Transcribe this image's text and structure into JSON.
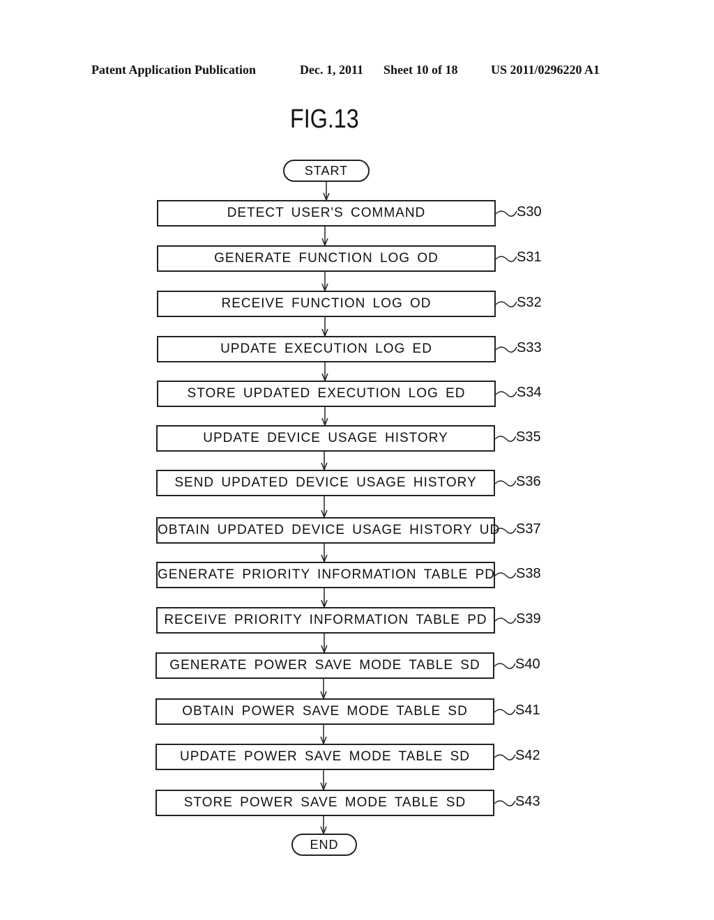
{
  "header": {
    "left": "Patent Application Publication",
    "date": "Dec. 1, 2011",
    "sheet": "Sheet 10 of 18",
    "number": "US 2011/0296220 A1"
  },
  "figure": {
    "title": "FIG.13",
    "start": "START",
    "end": "END",
    "steps": [
      {
        "id": "S30",
        "label": "DETECT USER'S COMMAND"
      },
      {
        "id": "S31",
        "label": "GENERATE FUNCTION LOG OD"
      },
      {
        "id": "S32",
        "label": "RECEIVE FUNCTION LOG OD"
      },
      {
        "id": "S33",
        "label": "UPDATE EXECUTION LOG ED"
      },
      {
        "id": "S34",
        "label": "STORE UPDATED EXECUTION LOG ED"
      },
      {
        "id": "S35",
        "label": "UPDATE DEVICE USAGE HISTORY"
      },
      {
        "id": "S36",
        "label": "SEND UPDATED DEVICE USAGE HISTORY"
      },
      {
        "id": "S37",
        "label": "OBTAIN UPDATED DEVICE USAGE HISTORY UD"
      },
      {
        "id": "S38",
        "label": "GENERATE PRIORITY INFORMATION TABLE PD"
      },
      {
        "id": "S39",
        "label": "RECEIVE PRIORITY INFORMATION TABLE PD"
      },
      {
        "id": "S40",
        "label": "GENERATE POWER SAVE MODE TABLE SD"
      },
      {
        "id": "S41",
        "label": "OBTAIN POWER SAVE MODE TABLE SD"
      },
      {
        "id": "S42",
        "label": "UPDATE POWER SAVE MODE TABLE SD"
      },
      {
        "id": "S43",
        "label": "STORE POWER SAVE MODE TABLE SD"
      }
    ]
  }
}
